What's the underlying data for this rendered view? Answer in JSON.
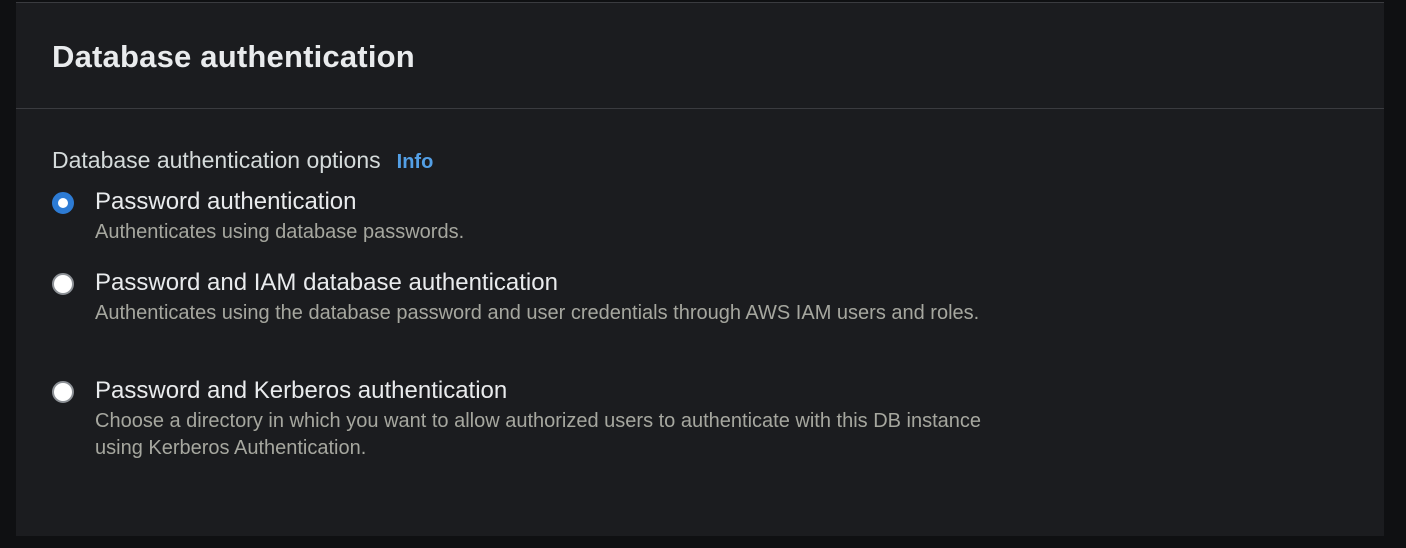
{
  "section": {
    "title": "Database authentication"
  },
  "auth_options": {
    "label": "Database authentication options",
    "info_link": "Info",
    "selected": "password",
    "options": [
      {
        "id": "password",
        "label": "Password authentication",
        "description": "Authenticates using database passwords.",
        "checked": true
      },
      {
        "id": "password-iam",
        "label": "Password and IAM database authentication",
        "description": "Authenticates using the database password and user credentials through AWS IAM users and roles.",
        "checked": false
      },
      {
        "id": "password-kerberos",
        "label": "Password and Kerberos authentication",
        "description": "Choose a directory in which you want to allow authorized users to authenticate with this DB instance using Kerberos Authentication.",
        "checked": false
      }
    ]
  },
  "colors": {
    "accent": "#2d7bd4",
    "link": "#539fe5",
    "panel_background": "#1b1c1f"
  }
}
